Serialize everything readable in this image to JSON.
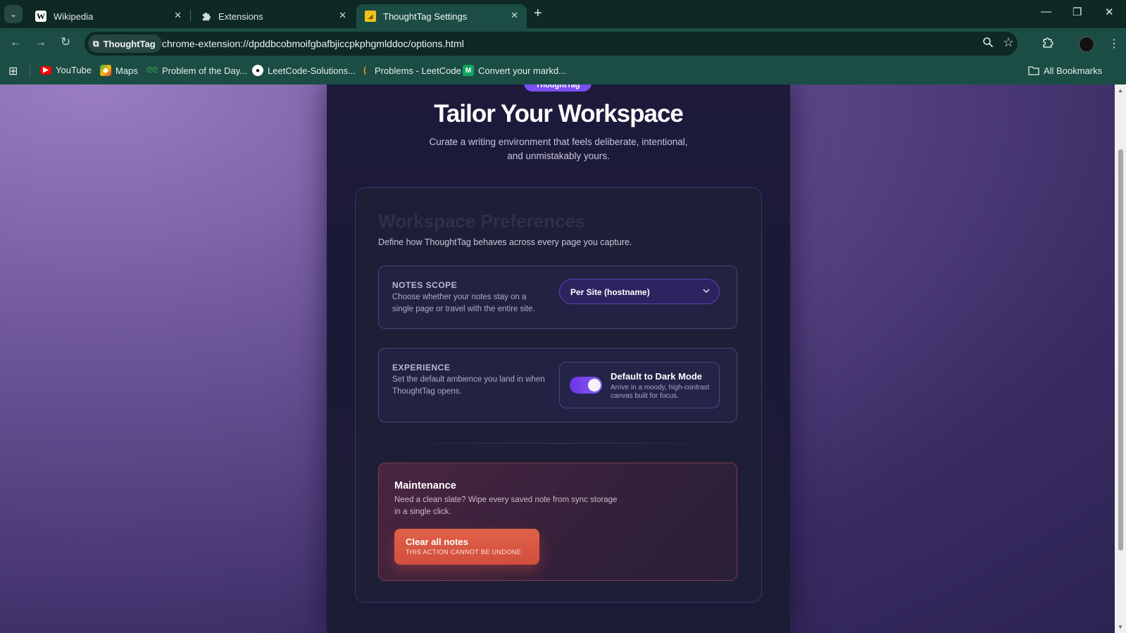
{
  "browser": {
    "tabs": [
      {
        "title": "Wikipedia",
        "icon": "wikipedia-icon",
        "active": false
      },
      {
        "title": "Extensions",
        "icon": "puzzle-icon",
        "active": false
      },
      {
        "title": "ThoughtTag Settings",
        "icon": "sticky-note-icon",
        "active": true
      }
    ],
    "site_chip": "ThoughtTag",
    "url": "chrome-extension://dpddbcobmoifgbafbjiccpkphgmlddoc/options.html",
    "bookmarks": [
      {
        "label": "YouTube",
        "icon": "youtube-icon"
      },
      {
        "label": "Maps",
        "icon": "maps-icon"
      },
      {
        "label": "Problem of the Day...",
        "icon": "gfg-icon"
      },
      {
        "label": "LeetCode-Solutions...",
        "icon": "github-icon"
      },
      {
        "label": "Problems - LeetCode",
        "icon": "leetcode-icon"
      },
      {
        "label": "Convert your markd...",
        "icon": "markdown-icon"
      }
    ],
    "all_bookmarks": "All Bookmarks"
  },
  "page": {
    "brand_pill": "ThoughtTag",
    "title": "Tailor Your Workspace",
    "subtitle": "Curate a writing environment that feels deliberate, intentional, and unmistakably yours.",
    "card": {
      "title": "Workspace Preferences",
      "description": "Define how ThoughtTag behaves across every page you capture.",
      "notes_scope": {
        "label": "NOTES SCOPE",
        "help": "Choose whether your notes stay on a single page or travel with the entire site.",
        "selected": "Per Site (hostname)"
      },
      "experience": {
        "label": "EXPERIENCE",
        "help": "Set the default ambience you land in when ThoughtTag opens.",
        "toggle_title": "Default to Dark Mode",
        "toggle_sub": "Arrive in a moody, high-contrast canvas built for focus.",
        "enabled": true
      },
      "maintenance": {
        "title": "Maintenance",
        "description": "Need a clean slate? Wipe every saved note from sync storage in a single click.",
        "button_label": "Clear all notes",
        "button_sub": "THIS ACTION CANNOT BE UNDONE"
      }
    }
  },
  "colors": {
    "accent": "#7b4ff0",
    "danger": "#e06148",
    "chrome": "#1b4d45"
  }
}
